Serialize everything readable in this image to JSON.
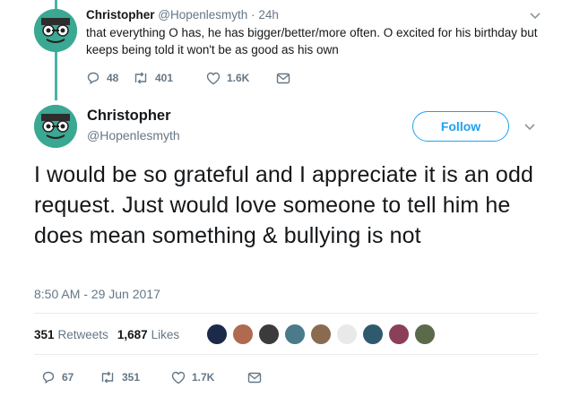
{
  "parent_tweet": {
    "name": "Christopher",
    "handle": "@Hopenlesmyth",
    "separator": "·",
    "time": "24h",
    "text": "that everything O has, he has bigger/better/more often. O excited for his birthday but keeps being told it won't be as good as his own",
    "replies": "48",
    "retweets": "401",
    "likes": "1.6K"
  },
  "main_tweet": {
    "name": "Christopher",
    "handle": "@Hopenlesmyth",
    "follow_label": "Follow",
    "text": "I would be so grateful and I appreciate it is an odd request. Just would love someone to tell him he does mean something & bullying is not",
    "timestamp": "8:50 AM - 29 Jun 2017",
    "retweet_count": "351",
    "retweet_label": "Retweets",
    "like_count": "1,687",
    "like_label": "Likes",
    "replies": "67",
    "retweets": "351",
    "likes": "1.7K"
  },
  "colors": {
    "accent": "#1da1f2",
    "muted": "#657786",
    "thread_line": "#4ab3a8",
    "avatar_bg": "#3aa892"
  },
  "icons": [
    "reply-icon",
    "retweet-icon",
    "like-icon",
    "message-icon",
    "chevron-down-icon"
  ],
  "liker_avatar_colors": [
    "#1c2a4a",
    "#b06a4f",
    "#3b3b3b",
    "#4b7a8a",
    "#8a6b4f",
    "#e9e9e9",
    "#2f5a6e",
    "#8b3f5a",
    "#5a6a4a"
  ]
}
